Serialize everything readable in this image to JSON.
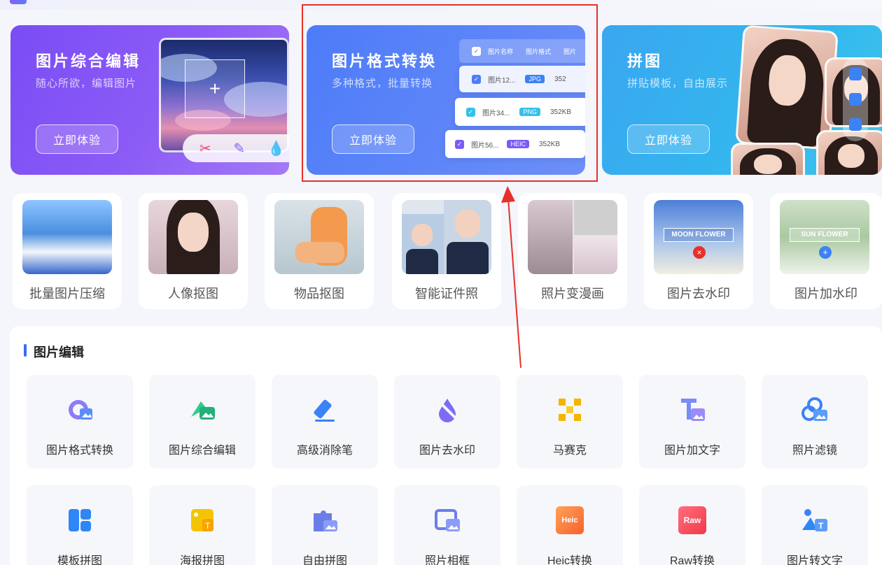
{
  "banners": [
    {
      "title": "图片综合编辑",
      "subtitle": "随心所欲，编辑图片",
      "button": "立即体验"
    },
    {
      "title": "图片格式转换",
      "subtitle": "多种格式，批量转换",
      "button": "立即体验"
    },
    {
      "title": "拼图",
      "subtitle": "拼贴模板，自由展示",
      "button": "立即体验"
    }
  ],
  "convert_table": {
    "headers": [
      "图片名称",
      "图片格式",
      "图片"
    ],
    "rows": [
      {
        "name": "图片12...",
        "format": "JPG",
        "size": "352"
      },
      {
        "name": "图片34...",
        "format": "PNG",
        "size": "352KB"
      },
      {
        "name": "图片56...",
        "format": "HEIC",
        "size": "352KB"
      }
    ]
  },
  "quick_tools": [
    {
      "label": "批量图片压缩"
    },
    {
      "label": "人像抠图"
    },
    {
      "label": "物品抠图"
    },
    {
      "label": "智能证件照"
    },
    {
      "label": "照片变漫画"
    },
    {
      "label": "图片去水印",
      "overlay": "MOON FLOWER"
    },
    {
      "label": "图片加水印",
      "overlay": "SUN FLOWER"
    }
  ],
  "section": {
    "title": "图片编辑",
    "tools_row1": [
      {
        "label": "图片格式转换",
        "icon": "format-convert-icon"
      },
      {
        "label": "图片综合编辑",
        "icon": "image-edit-icon"
      },
      {
        "label": "高级消除笔",
        "icon": "eraser-pen-icon"
      },
      {
        "label": "图片去水印",
        "icon": "remove-watermark-icon"
      },
      {
        "label": "马赛克",
        "icon": "mosaic-icon"
      },
      {
        "label": "图片加文字",
        "icon": "add-text-icon"
      },
      {
        "label": "照片滤镜",
        "icon": "filter-icon"
      }
    ],
    "tools_row2": [
      {
        "label": "模板拼图",
        "icon": "template-collage-icon"
      },
      {
        "label": "海报拼图",
        "icon": "poster-collage-icon"
      },
      {
        "label": "自由拼图",
        "icon": "free-collage-icon"
      },
      {
        "label": "照片相框",
        "icon": "photo-frame-icon"
      },
      {
        "label": "Heic转换",
        "icon": "heic-icon",
        "badge": "Heic"
      },
      {
        "label": "Raw转换",
        "icon": "raw-icon",
        "badge": "Raw"
      },
      {
        "label": "图片转文字",
        "icon": "image-to-text-icon"
      }
    ]
  },
  "colors": {
    "highlight": "#e8302a",
    "accent": "#3b6cf6"
  }
}
